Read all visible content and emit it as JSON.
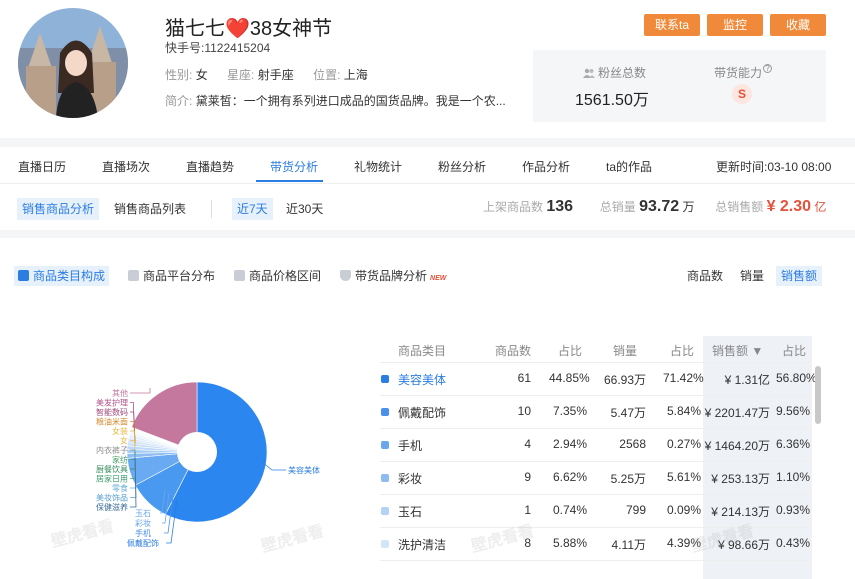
{
  "header": {
    "name": "猫七七❤️38女神节",
    "uid_label": "快手号:",
    "uid": "1122415204",
    "gender_label": "性别:",
    "gender": "女",
    "sign_label": "星座:",
    "sign": "射手座",
    "location_label": "位置:",
    "location": "上海",
    "bio_label": "简介:",
    "bio": "黛莱皙：一个拥有系列进口成品的国货品牌。我是一个农...",
    "buttons": {
      "contact": "联系ta",
      "monitor": "监控",
      "favorite": "收藏"
    },
    "fans_label": "粉丝总数",
    "fans_value": "1561.50万",
    "capability_label": "带货能力",
    "capability_value": "S"
  },
  "tabs": [
    "直播日历",
    "直播场次",
    "直播趋势",
    "带货分析",
    "礼物统计",
    "粉丝分析",
    "作品分析",
    "ta的作品"
  ],
  "active_tab": "带货分析",
  "update_time": "更新时间:03-10 08:00",
  "subbar": {
    "analysis": "销售商品分析",
    "list": "销售商品列表",
    "range_7": "近7天",
    "range_30": "近30天",
    "listed_label": "上架商品数",
    "listed_value": "136",
    "volume_label": "总销量",
    "volume_value": "93.72",
    "volume_unit": "万",
    "amount_label": "总销售额",
    "amount_value": "¥ 2.30",
    "amount_unit": "亿"
  },
  "main_tabs": {
    "category": "商品类目构成",
    "platform": "商品平台分布",
    "price": "商品价格区间",
    "brand": "带货品牌分析",
    "new_tag": "NEW"
  },
  "metric_options": {
    "count": "商品数",
    "volume": "销量",
    "amount": "销售额"
  },
  "table": {
    "headers": [
      "商品类目",
      "商品数",
      "占比",
      "销量",
      "占比",
      "销售额 ▼",
      "占比"
    ],
    "rows": [
      {
        "color": "#2b7de1",
        "cat": "美容美体",
        "count": "61",
        "count_pct": "44.85%",
        "volume": "66.93万",
        "volume_pct": "71.42%",
        "amount": "¥ 1.31亿",
        "amount_pct": "56.80%"
      },
      {
        "color": "#4a90e8",
        "cat": "佩戴配饰",
        "count": "10",
        "count_pct": "7.35%",
        "volume": "5.47万",
        "volume_pct": "5.84%",
        "amount": "¥ 2201.47万",
        "amount_pct": "9.56%"
      },
      {
        "color": "#6aa6ec",
        "cat": "手机",
        "count": "4",
        "count_pct": "2.94%",
        "volume": "2568",
        "volume_pct": "0.27%",
        "amount": "¥ 1464.20万",
        "amount_pct": "6.36%"
      },
      {
        "color": "#8dbcf0",
        "cat": "彩妆",
        "count": "9",
        "count_pct": "6.62%",
        "volume": "5.25万",
        "volume_pct": "5.61%",
        "amount": "¥ 253.13万",
        "amount_pct": "1.10%"
      },
      {
        "color": "#b3d3f5",
        "cat": "玉石",
        "count": "1",
        "count_pct": "0.74%",
        "volume": "799",
        "volume_pct": "0.09%",
        "amount": "¥ 214.13万",
        "amount_pct": "0.93%"
      },
      {
        "color": "#d3e5f9",
        "cat": "洗护清洁",
        "count": "8",
        "count_pct": "5.88%",
        "volume": "4.11万",
        "volume_pct": "4.39%",
        "amount": "¥ 98.66万",
        "amount_pct": "0.43%"
      }
    ]
  },
  "pie": {
    "slices": [
      {
        "label": "美容美体",
        "value": 56.8,
        "color": "#2b86f0"
      },
      {
        "label": "佩戴配饰",
        "value": 9.56,
        "color": "#4a99f0"
      },
      {
        "label": "手机",
        "value": 6.36,
        "color": "#6aaaf2"
      },
      {
        "label": "彩妆",
        "value": 1.1,
        "color": "#8dbdf3"
      },
      {
        "label": "玉石",
        "value": 0.93,
        "color": "#a9cdf5"
      },
      {
        "label": "保健滋养",
        "value": 0.8,
        "color": "#bcd8f6"
      },
      {
        "label": "美妆饰品",
        "value": 0.7,
        "color": "#c8dff7"
      },
      {
        "label": "零食",
        "value": 0.6,
        "color": "#cfe3f8"
      },
      {
        "label": "居家日用",
        "value": 0.5,
        "color": "#d6e8f9"
      },
      {
        "label": "厨餐饮具",
        "value": 0.5,
        "color": "#ddeefa"
      },
      {
        "label": "家纺",
        "value": 0.4,
        "color": "#e3f0fb"
      },
      {
        "label": "内衣裤子",
        "value": 0.4,
        "color": "#e8f3fb"
      },
      {
        "label": "女装",
        "value": 0.3,
        "color": "#eef5fc"
      },
      {
        "label": "粮油米面",
        "value": 0.3,
        "color": "#f1f7fc"
      },
      {
        "label": "智能数码",
        "value": 0.3,
        "color": "#f4f8fd"
      },
      {
        "label": "美发护理",
        "value": 0.3,
        "color": "#f7fafd"
      },
      {
        "label": "其他",
        "value": 19.0,
        "color": "#c4789e"
      }
    ],
    "left_labels": [
      {
        "text": "其他",
        "color": "#c4789e"
      },
      {
        "text": "美发护理",
        "color": "#b0538a"
      },
      {
        "text": "智能数码",
        "color": "#a04a7c"
      },
      {
        "text": "粮油米面",
        "color": "#d08a2c"
      },
      {
        "text": "女装",
        "color": "#e6b84a"
      },
      {
        "text": "女",
        "color": "#e6b84a"
      },
      {
        "text": "内衣裤子",
        "color": "#8c8c8c"
      },
      {
        "text": "家纺",
        "color": "#4aa06a"
      },
      {
        "text": "厨餐饮具",
        "color": "#2e8b57"
      },
      {
        "text": "居家日用",
        "color": "#3c9c6e"
      },
      {
        "text": "零食",
        "color": "#6ab0d8"
      },
      {
        "text": "美妆饰品",
        "color": "#5ba0d0"
      },
      {
        "text": "保健滋养",
        "color": "#3a6a9a"
      }
    ],
    "bottom_labels": [
      {
        "text": "玉石",
        "color": "#6aa6ec"
      },
      {
        "text": "彩妆",
        "color": "#6aa6ec"
      },
      {
        "text": "手机",
        "color": "#4a90e8"
      },
      {
        "text": "佩戴配饰",
        "color": "#2b7de1"
      }
    ],
    "right_label": {
      "text": "美容美体",
      "color": "#2b7de1"
    }
  },
  "watermark": "壁虎看看"
}
